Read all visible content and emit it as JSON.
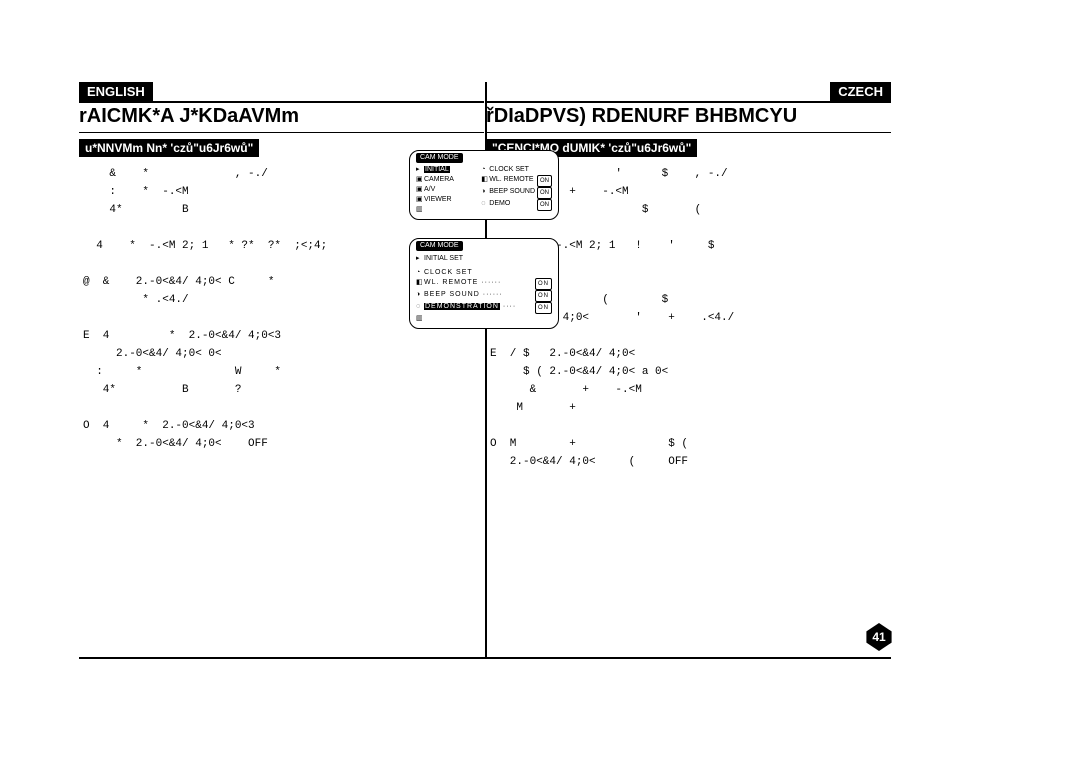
{
  "left": {
    "lang": "ENGLISH",
    "title": "rAICMK*A J*KDaAVMm",
    "subhead": "u*NNVMm Nn* 'czů\"u6Jr6wů\"",
    "body": "    &    *             , -./\n    :    *  -.<M\n    4*         B\n\n  4    *  -.<M 2; 1   * ?*  ?*  ;<;4;\n\n@  &    2.-0<&4/ 4;0< C     *\n         * .<4./\n\nE  4         *  2.-0<&4/ 4;0<3\n     2.-0<&4/ 4;0< 0<\n  :     *              W     *\n   4*          B       ?\n\nO  4     *  2.-0<&4/ 4;0<3\n     *  2.-0<&4/ 4;0<    OFF"
  },
  "right": {
    "lang": "CZECH",
    "title": "řDIaDPVS) RDENURF BHBMCYU",
    "subhead": "\"CENCI*MO dUMIK* 'czů\"u6Jr6wů\"",
    "body": "    #              '      $    , -./\n  &    '    +    -.<M\n       >               $       (\n\n  0    +  -.<M 2; 1   !    '     $\n  ;<;4; 1\n\n@  >    +        (        $\n  2.-0<&4/ 4;0<       '    +    .<4./\n\nE  / $   2.-0<&4/ 4;0<\n     $ ( 2.-0<&4/ 4;0< a 0<\n      &       +    -.<M\n    M       +\n\nO  M        +              $ (\n   2.-0<&4/ 4;0<     (     OFF"
  },
  "menu1": {
    "title": "CAM MODE",
    "col1": [
      "INITIAL",
      "CAMERA",
      "A/V",
      "VIEWER"
    ],
    "col2_labels": [
      "CLOCK SET",
      "WL. REMOTE",
      "BEEP SOUND",
      "DEMO"
    ],
    "col2_states": [
      "",
      "ON",
      "ON",
      "ON"
    ]
  },
  "menu2": {
    "title": "CAM MODE",
    "sub": "INITIAL SET",
    "rows_labels": [
      "CLOCK SET",
      "WL. REMOTE",
      "BEEP SOUND",
      "DEMONSTRATION"
    ],
    "rows_states": [
      "",
      "ON",
      "ON",
      "ON"
    ]
  },
  "page_number": "41"
}
